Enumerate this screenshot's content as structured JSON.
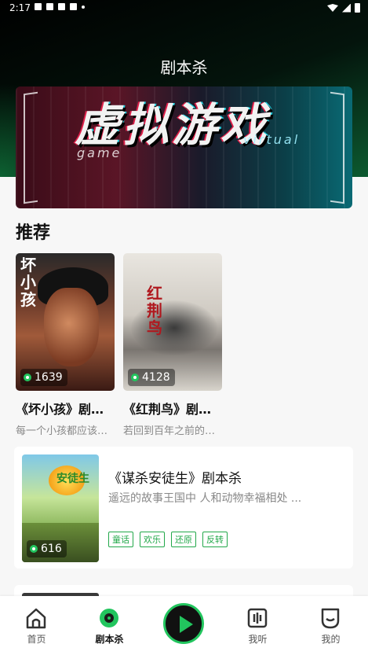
{
  "status_bar": {
    "time": "2:17"
  },
  "header": {
    "title": "剧本杀"
  },
  "banner": {
    "main_text": "虚拟游戏",
    "sub_left": "game",
    "sub_right": "virtual"
  },
  "section": {
    "title": "推荐"
  },
  "recommend": [
    {
      "title": "《坏小孩》剧本杀",
      "desc": "每一个小孩都应该被爱",
      "count": "1639",
      "cover_text": "坏小孩"
    },
    {
      "title": "《红荆鸟》剧本杀",
      "desc": "若回到百年之前的那一天",
      "count": "4128",
      "cover_text": "红荆鸟"
    }
  ],
  "list": [
    {
      "title": "《谋杀安徒生》剧本杀",
      "desc": "遥远的故事王国中 人和动物幸福相处 ...",
      "count": "616",
      "cover_text": "安徒生",
      "tags": [
        "童话",
        "欢乐",
        "还原",
        "反转"
      ]
    }
  ],
  "tabbar": {
    "home": "首页",
    "script": "剧本杀",
    "listen": "我听",
    "mine": "我的"
  },
  "colors": {
    "accent": "#22c55e",
    "tag": "#22a84a"
  }
}
